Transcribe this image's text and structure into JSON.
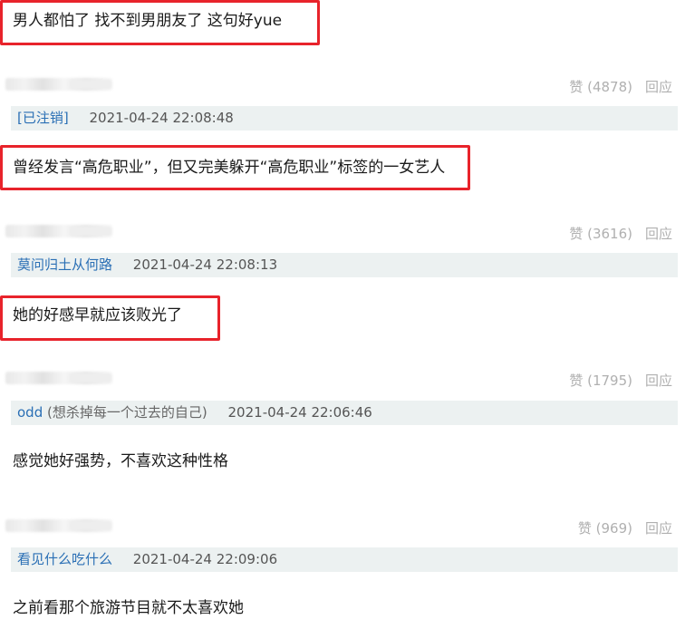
{
  "comments": [
    {
      "quote": "男人都怕了 找不到男朋友了 这句好yue",
      "likes": "赞 (4878)",
      "reply": "回应",
      "user": "[已注销]",
      "user_sub": "",
      "time": "2021-04-24 22:08:48"
    },
    {
      "quote": "曾经发言“高危职业”，但又完美躲开“高危职业”标签的一女艺人",
      "likes": "赞 (3616)",
      "reply": "回应",
      "user": "莫问归土从何路",
      "user_sub": "",
      "time": "2021-04-24 22:08:13"
    },
    {
      "quote": "她的好感早就应该败光了",
      "likes": "赞 (1795)",
      "reply": "回应",
      "user": "odd",
      "user_sub": "(想杀掉每一个过去的自己)",
      "time": "2021-04-24 22:06:46"
    },
    {
      "quote": "感觉她好强势，不喜欢这种性格",
      "likes": "赞 (969)",
      "reply": "回应",
      "user": "看见什么吃什么",
      "user_sub": "",
      "time": "2021-04-24 22:09:06"
    },
    {
      "quote": "之前看那个旅游节目就不太喜欢她"
    }
  ],
  "colors": {
    "highlight_border": "#e8232b",
    "username_link": "#2a6fb5",
    "meta_background": "#ecf1f1",
    "muted_text": "#b0b0b0"
  }
}
